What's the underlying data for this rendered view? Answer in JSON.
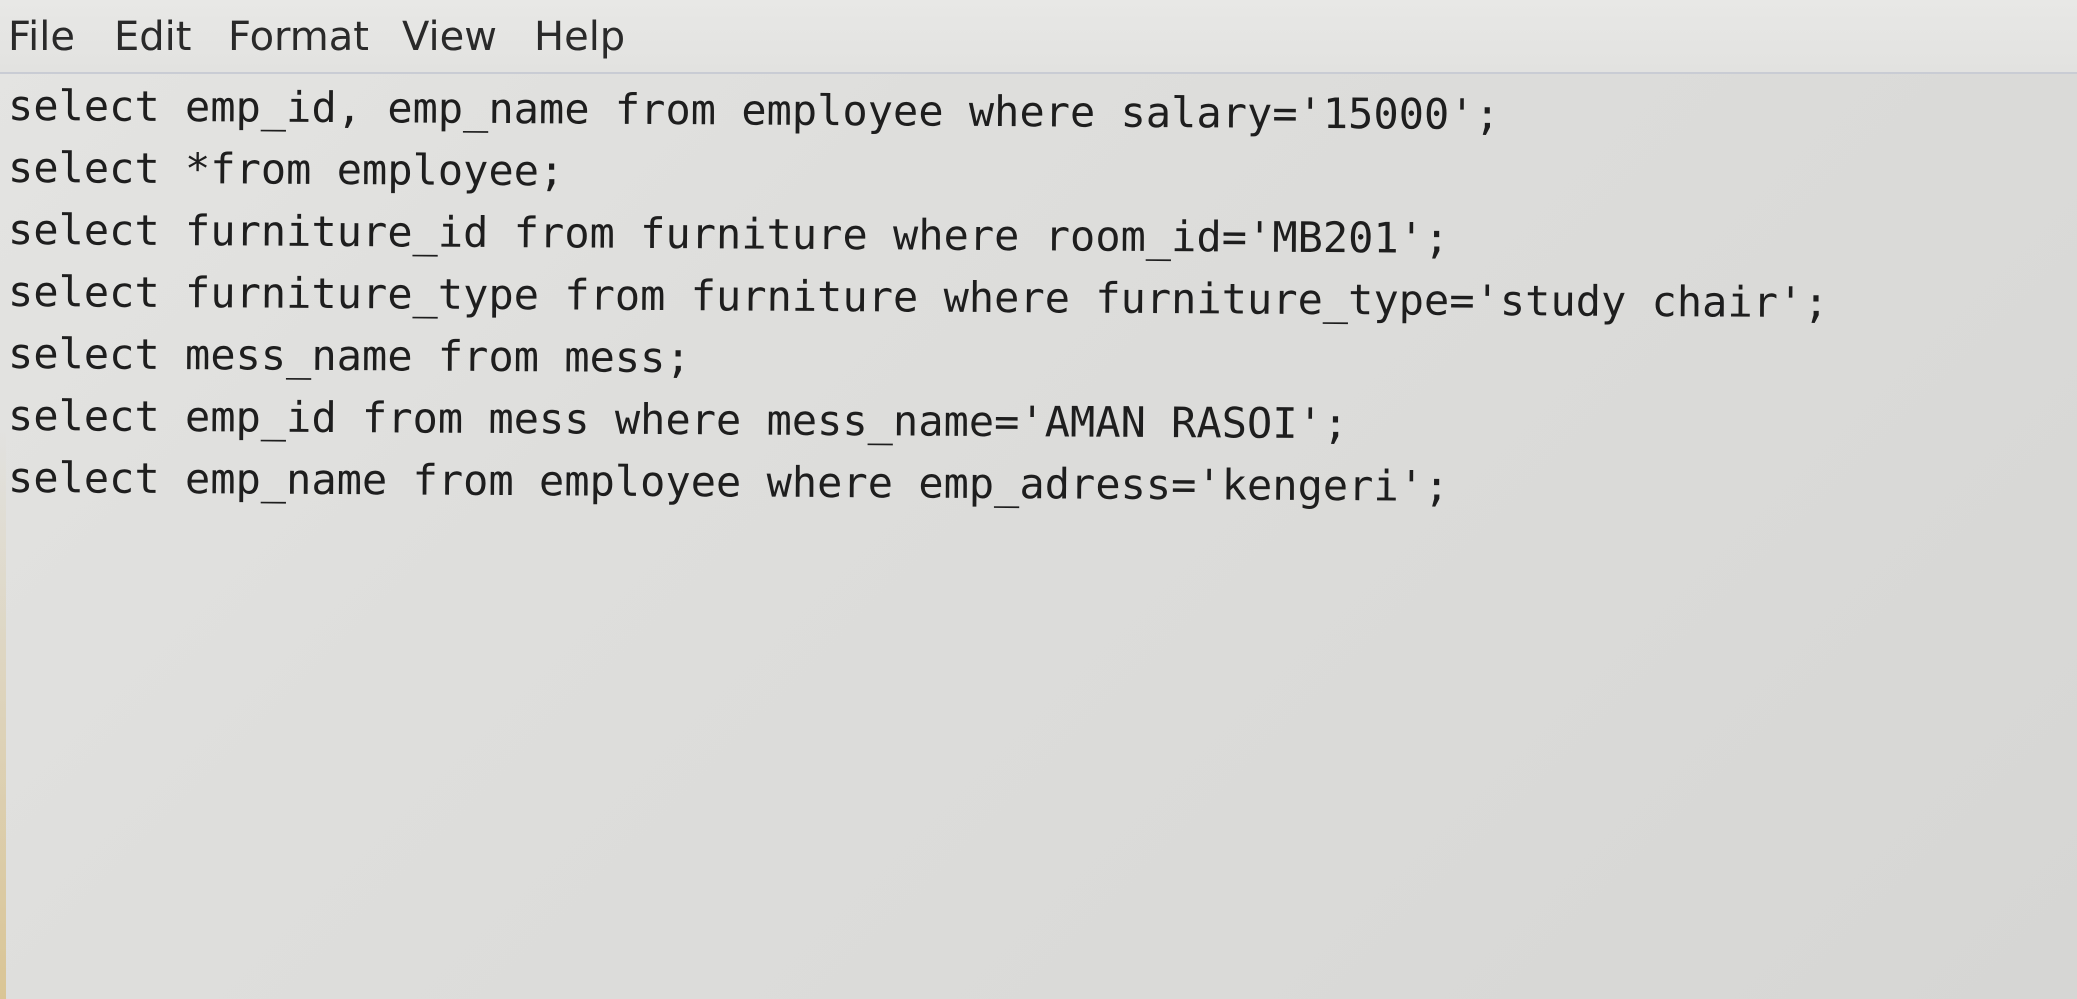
{
  "menu": {
    "items": [
      "File",
      "Edit",
      "Format",
      "View",
      "Help"
    ]
  },
  "editor": {
    "lines": [
      "select emp_id, emp_name from employee where salary='15000';",
      "select *from employee;",
      "select furniture_id from furniture where room_id='MB201';",
      "select furniture_type from furniture where furniture_type='study chair';",
      "select mess_name from mess;",
      "select emp_id from mess where mess_name='AMAN RASOI';",
      "select emp_name from employee where emp_adress='kengeri';"
    ]
  }
}
